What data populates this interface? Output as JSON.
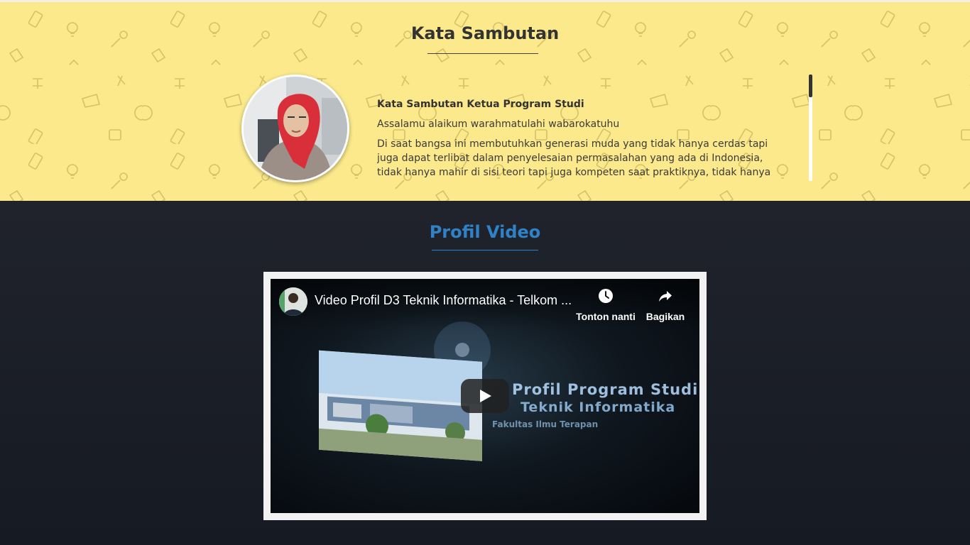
{
  "sambutan": {
    "title": "Kata Sambutan",
    "heading": "Kata Sambutan Ketua Program Studi",
    "greeting": "Assalamu alaikum warahmatulahi wabarokatuhu",
    "paragraph": "Di saat bangsa ini membutuhkan generasi muda yang tidak hanya cerdas tapi juga dapat terlibat dalam penyelesaian permasalahan yang ada di Indonesia, tidak hanya mahir di sisi teori tapi juga kompeten saat praktiknya, tidak hanya menjadi",
    "background_color": "#fbe98c"
  },
  "video_section": {
    "title": "Profil Video",
    "title_color": "#2f82c6",
    "player": {
      "video_title": "Video Profil D3 Teknik Informatika - Telkom ...",
      "watch_later_label": "Tonton nanti",
      "share_label": "Bagikan",
      "thumbnail_text": {
        "line1": "Profil Program Studi",
        "line2": "Teknik Informatika",
        "line3": "Fakultas Ilmu Terapan"
      },
      "icons": [
        "clock-icon",
        "share-icon",
        "play-icon"
      ]
    }
  }
}
